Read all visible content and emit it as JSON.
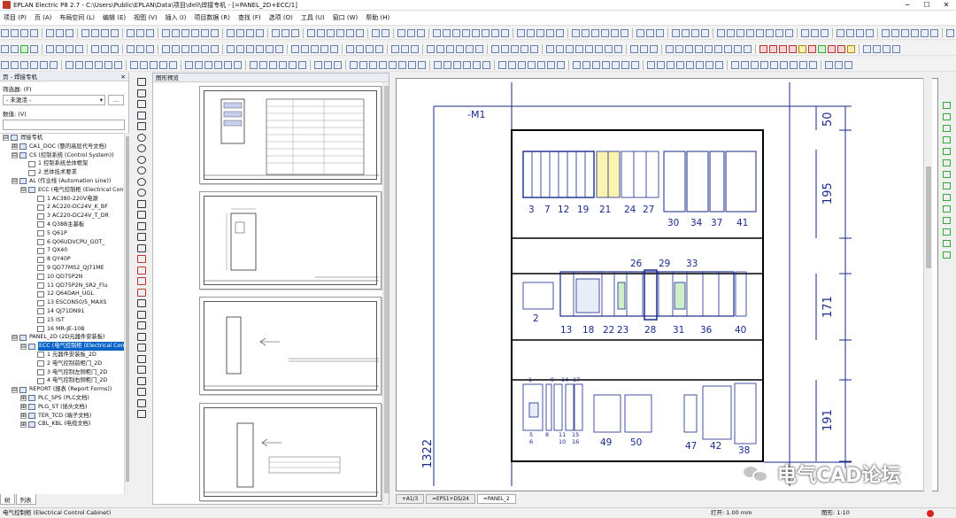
{
  "window": {
    "title": "EPLAN Electric P8 2.7 - C:\\Users\\Public\\EPLAN\\Data\\项目\\dell\\焊接专机 - [=PANEL_2D+ECC/1]",
    "minimize": "─",
    "maximize": "☐",
    "close": "✕"
  },
  "menu": [
    "项目 (P)",
    "页 (A)",
    "布局空间 (L)",
    "编辑 (E)",
    "视图 (V)",
    "插入 (I)",
    "项目数据 (R)",
    "查找 (F)",
    "选项 (O)",
    "工具 (U)",
    "窗口 (W)",
    "帮助 (H)"
  ],
  "page_panel": {
    "title": "页 - 焊接专机",
    "close": "✕",
    "filter_label": "筛选器: (F)",
    "filter_value": "- 未激活 -",
    "filter_button": "...",
    "numeric_label": "数值: (V)",
    "tabs": [
      "树",
      "列表"
    ]
  },
  "tree": [
    {
      "level": 0,
      "toggle": "⊟",
      "icon": "proj",
      "label": "焊接专机"
    },
    {
      "level": 1,
      "toggle": "⊞",
      "icon": "grp",
      "label": "CA1_DOC (整的高层代号文档)"
    },
    {
      "level": 1,
      "toggle": "⊟",
      "icon": "grp",
      "label": "CS (控制系统 (Control System))"
    },
    {
      "level": 2,
      "toggle": "",
      "icon": "pg",
      "label": "1 控制系统总体框架"
    },
    {
      "level": 2,
      "toggle": "",
      "icon": "pg",
      "label": "2 总体技术要求"
    },
    {
      "level": 1,
      "toggle": "⊟",
      "icon": "grp",
      "label": "AL (作业线 (Automation Line))"
    },
    {
      "level": 2,
      "toggle": "⊟",
      "icon": "grp",
      "label": "ECC (电气控制柜 (Electrical Control Cabinet))"
    },
    {
      "level": 3,
      "toggle": "",
      "icon": "pg",
      "label": "1 AC380-220V电源"
    },
    {
      "level": 3,
      "toggle": "",
      "icon": "pg",
      "label": "2 AC220-DC24V_K_BF"
    },
    {
      "level": 3,
      "toggle": "",
      "icon": "pg",
      "label": "3 AC220-DC24V_T_DR"
    },
    {
      "level": 3,
      "toggle": "",
      "icon": "pg",
      "label": "4 Q38B主基板"
    },
    {
      "level": 3,
      "toggle": "",
      "icon": "pg",
      "label": "5 Q61P"
    },
    {
      "level": 3,
      "toggle": "",
      "icon": "pg",
      "label": "6 Q06UDVCPU_GOT_"
    },
    {
      "level": 3,
      "toggle": "",
      "icon": "pg",
      "label": "7 QX40"
    },
    {
      "level": 3,
      "toggle": "",
      "icon": "pg",
      "label": "8 QY40P"
    },
    {
      "level": 3,
      "toggle": "",
      "icon": "pg",
      "label": "9 QD77MS2_QJ71ME"
    },
    {
      "level": 3,
      "toggle": "",
      "icon": "pg",
      "label": "10 QD75P2N"
    },
    {
      "level": 3,
      "toggle": "",
      "icon": "pg",
      "label": "11 QD75P2N_SR2_Flu"
    },
    {
      "level": 3,
      "toggle": "",
      "icon": "pg",
      "label": "12 Q64DAH_UGL"
    },
    {
      "level": 3,
      "toggle": "",
      "icon": "pg",
      "label": "13 ESCON50/5_MAXS"
    },
    {
      "level": 3,
      "toggle": "",
      "icon": "pg",
      "label": "14 QJ71DN91"
    },
    {
      "level": 3,
      "toggle": "",
      "icon": "pg",
      "label": "15 IST"
    },
    {
      "level": 3,
      "toggle": "",
      "icon": "pg",
      "label": "16 MR-JE-10B"
    },
    {
      "level": 1,
      "toggle": "⊟",
      "icon": "grp",
      "label": "PANEL_2D (2D元器件安装板)"
    },
    {
      "level": 2,
      "toggle": "⊟",
      "icon": "grp",
      "label": "ECC (电气控制柜 (Electrical Control Cabinet))",
      "selected": true
    },
    {
      "level": 3,
      "toggle": "",
      "icon": "pg",
      "label": "1 元器件安装板_2D"
    },
    {
      "level": 3,
      "toggle": "",
      "icon": "pg",
      "label": "2 电气控制前柜门_2D"
    },
    {
      "level": 3,
      "toggle": "",
      "icon": "pg",
      "label": "3 电气控制左侧柜门_2D"
    },
    {
      "level": 3,
      "toggle": "",
      "icon": "pg",
      "label": "4 电气控制右侧柜门_2D"
    },
    {
      "level": 1,
      "toggle": "⊟",
      "icon": "grp",
      "label": "REPORT (报表 (Report Forms))"
    },
    {
      "level": 2,
      "toggle": "⊞",
      "icon": "grp",
      "label": "PLC_SPS (PLC文档)"
    },
    {
      "level": 2,
      "toggle": "⊞",
      "icon": "grp",
      "label": "PLG_ST (插头文档)"
    },
    {
      "level": 2,
      "toggle": "⊞",
      "icon": "grp",
      "label": "TER_TCD (端子文档)"
    },
    {
      "level": 2,
      "toggle": "⊞",
      "icon": "grp",
      "label": "CBL_KBL (电缆文档)"
    }
  ],
  "preview_panel": {
    "title": "图形预览"
  },
  "drawing": {
    "cabinet_label": "-M1",
    "height_total": "1322",
    "row_heights": [
      "50",
      "195",
      "171",
      "191"
    ],
    "row1_labels": [
      "3",
      "7",
      "12",
      "19",
      "21",
      "24",
      "27",
      "30",
      "34",
      "37",
      "41"
    ],
    "row2_top_labels": [
      "26",
      "29",
      "33"
    ],
    "row2_labels": [
      "2",
      "13",
      "18",
      "22",
      "23",
      "28",
      "31",
      "36",
      "40"
    ],
    "row3_top_labels": [
      "1",
      "9",
      "14",
      "17"
    ],
    "row3_bottom_labels": [
      "5",
      "8",
      "11",
      "15",
      "6",
      "10",
      "16",
      "49",
      "50",
      "47",
      "42",
      "38"
    ]
  },
  "doc_tabs": [
    "+A1/3",
    "=EPS1+DS/24",
    "=PANEL_2"
  ],
  "status": {
    "left": "电气控制柜 (Electrical Control Cabinet)",
    "open": "打开: 1.00 mm",
    "scale": "图形: 1:10"
  },
  "watermark": {
    "text": "电气CAD论坛"
  },
  "colors": {
    "drawing_blue": "#1a2a8c",
    "selection": "#0a64c8"
  }
}
